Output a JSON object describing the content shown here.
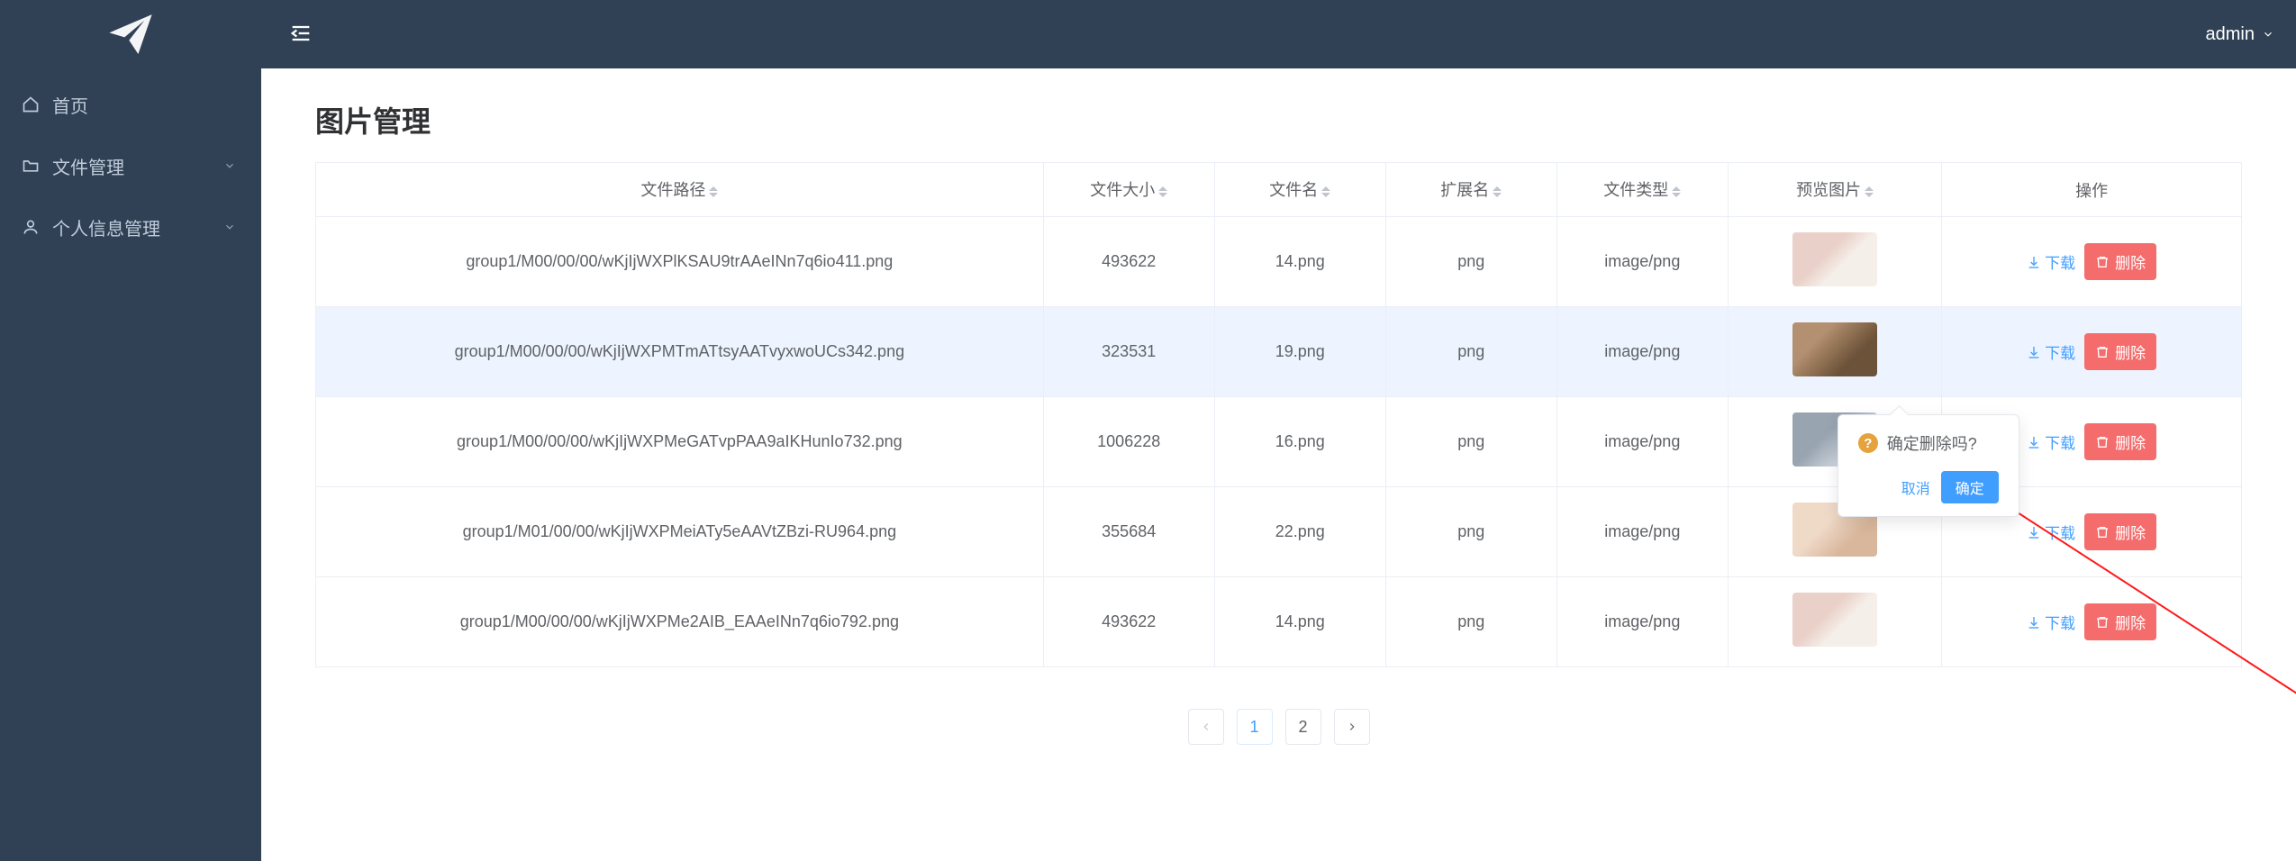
{
  "header": {
    "user_name": "admin"
  },
  "sidebar": {
    "items": [
      {
        "label": "首页"
      },
      {
        "label": "文件管理"
      },
      {
        "label": "个人信息管理"
      }
    ]
  },
  "page": {
    "title": "图片管理"
  },
  "table": {
    "columns": {
      "path": "文件路径",
      "size": "文件大小",
      "name": "文件名",
      "ext": "扩展名",
      "type": "文件类型",
      "thumb": "预览图片",
      "ops": "操作"
    },
    "download_label": "下载",
    "delete_label": "删除",
    "rows": [
      {
        "path": "group1/M00/00/00/wKjIjWXPlKSAU9trAAeINn7q6io411.png",
        "size": "493622",
        "name": "14.png",
        "ext": "png",
        "type": "image/png"
      },
      {
        "path": "group1/M00/00/00/wKjIjWXPMTmATtsyAATvyxwoUCs342.png",
        "size": "323531",
        "name": "19.png",
        "ext": "png",
        "type": "image/png"
      },
      {
        "path": "group1/M00/00/00/wKjIjWXPMeGATvpPAA9aIKHunIo732.png",
        "size": "1006228",
        "name": "16.png",
        "ext": "png",
        "type": "image/png"
      },
      {
        "path": "group1/M01/00/00/wKjIjWXPMeiATy5eAAVtZBzi-RU964.png",
        "size": "355684",
        "name": "22.png",
        "ext": "png",
        "type": "image/png"
      },
      {
        "path": "group1/M00/00/00/wKjIjWXPMe2AIB_EAAeINn7q6io792.png",
        "size": "493622",
        "name": "14.png",
        "ext": "png",
        "type": "image/png"
      }
    ]
  },
  "pager": {
    "current": "1",
    "other": "2"
  },
  "popconfirm": {
    "text": "确定删除吗?",
    "cancel": "取消",
    "ok": "确定"
  }
}
